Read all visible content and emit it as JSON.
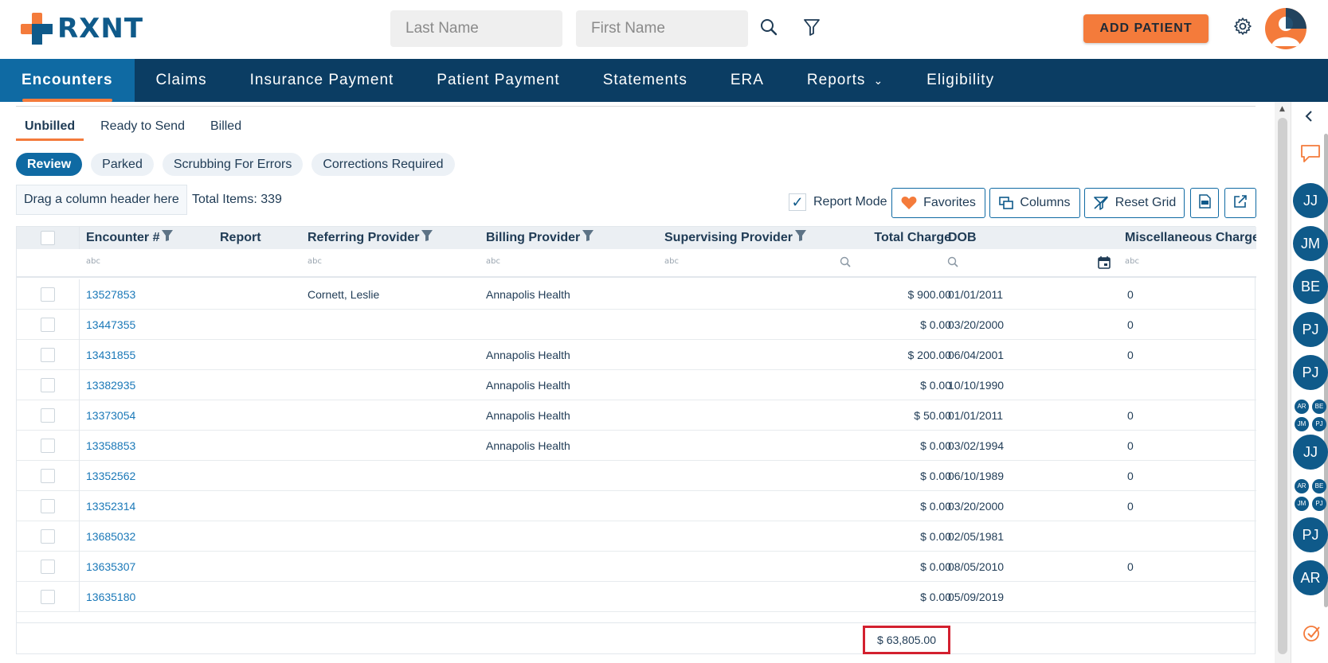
{
  "brand": {
    "name": "RXNT"
  },
  "header": {
    "last_name_placeholder": "Last Name",
    "first_name_placeholder": "First Name",
    "add_patient_label": "ADD PATIENT",
    "icons": [
      "search-icon",
      "filter-icon",
      "gear-icon",
      "user-avatar-icon"
    ]
  },
  "nav": {
    "items": [
      {
        "label": "Encounters",
        "active": true
      },
      {
        "label": "Claims"
      },
      {
        "label": "Insurance Payment"
      },
      {
        "label": "Patient Payment"
      },
      {
        "label": "Statements"
      },
      {
        "label": "ERA"
      },
      {
        "label": "Reports",
        "has_dropdown": true
      },
      {
        "label": "Eligibility"
      }
    ]
  },
  "subtabs": [
    {
      "label": "Unbilled",
      "active": true
    },
    {
      "label": "Ready to Send"
    },
    {
      "label": "Billed"
    }
  ],
  "chips": [
    {
      "label": "Review",
      "active": true
    },
    {
      "label": "Parked"
    },
    {
      "label": "Scrubbing For Errors"
    },
    {
      "label": "Corrections Required"
    }
  ],
  "toolbar": {
    "group_panel": "Drag a column header here",
    "total_items": "Total Items: 339",
    "report_mode_label": "Report Mode",
    "report_mode_checked": true,
    "favorites_label": "Favorites",
    "columns_label": "Columns",
    "reset_grid_label": "Reset Grid"
  },
  "grid": {
    "columns": [
      "Encounter #",
      "Report",
      "Referring Provider",
      "Billing Provider",
      "Supervising Provider",
      "Total Charge",
      "DOB",
      "Miscellaneous Charges"
    ],
    "filter_hint": "a͏b͏c",
    "rows": [
      {
        "encounter": "13527853",
        "report": "",
        "referring": "Cornett, Leslie",
        "billing": "Annapolis Health",
        "supervising": "",
        "total": "$ 900.00",
        "dob": "01/01/2011",
        "misc": "0"
      },
      {
        "encounter": "13447355",
        "report": "",
        "referring": "",
        "billing": "",
        "supervising": "",
        "total": "$ 0.00",
        "dob": "03/20/2000",
        "misc": "0"
      },
      {
        "encounter": "13431855",
        "report": "",
        "referring": "",
        "billing": "Annapolis Health",
        "supervising": "",
        "total": "$ 200.00",
        "dob": "06/04/2001",
        "misc": "0"
      },
      {
        "encounter": "13382935",
        "report": "",
        "referring": "",
        "billing": "Annapolis Health",
        "supervising": "",
        "total": "$ 0.00",
        "dob": "10/10/1990",
        "misc": ""
      },
      {
        "encounter": "13373054",
        "report": "",
        "referring": "",
        "billing": "Annapolis Health",
        "supervising": "",
        "total": "$ 50.00",
        "dob": "01/01/2011",
        "misc": "0"
      },
      {
        "encounter": "13358853",
        "report": "",
        "referring": "",
        "billing": "Annapolis Health",
        "supervising": "",
        "total": "$ 0.00",
        "dob": "03/02/1994",
        "misc": "0"
      },
      {
        "encounter": "13352562",
        "report": "",
        "referring": "",
        "billing": "",
        "supervising": "",
        "total": "$ 0.00",
        "dob": "06/10/1989",
        "misc": "0"
      },
      {
        "encounter": "13352314",
        "report": "",
        "referring": "",
        "billing": "",
        "supervising": "",
        "total": "$ 0.00",
        "dob": "03/20/2000",
        "misc": "0"
      },
      {
        "encounter": "13685032",
        "report": "",
        "referring": "",
        "billing": "",
        "supervising": "",
        "total": "$ 0.00",
        "dob": "02/05/1981",
        "misc": ""
      },
      {
        "encounter": "13635307",
        "report": "",
        "referring": "",
        "billing": "",
        "supervising": "",
        "total": "$ 0.00",
        "dob": "08/05/2010",
        "misc": "0"
      },
      {
        "encounter": "13635180",
        "report": "",
        "referring": "",
        "billing": "",
        "supervising": "",
        "total": "$ 0.00",
        "dob": "05/09/2019",
        "misc": ""
      }
    ],
    "total_charge_sum": "$ 63,805.00"
  },
  "rail": {
    "avatars": [
      "JJ",
      "JM",
      "BE",
      "PJ",
      "PJ",
      "JJ",
      "PJ",
      "AR"
    ],
    "group_avatars": [
      [
        "AR",
        "BE",
        "JM",
        "PJ"
      ],
      [
        "AR",
        "BE",
        "JM",
        "PJ"
      ]
    ]
  },
  "colors": {
    "brand_orange": "#f47b3b",
    "nav_bg": "#0b3d63",
    "nav_active": "#0f6aa3",
    "link": "#1a78b8",
    "highlight_red": "#d3202f"
  }
}
